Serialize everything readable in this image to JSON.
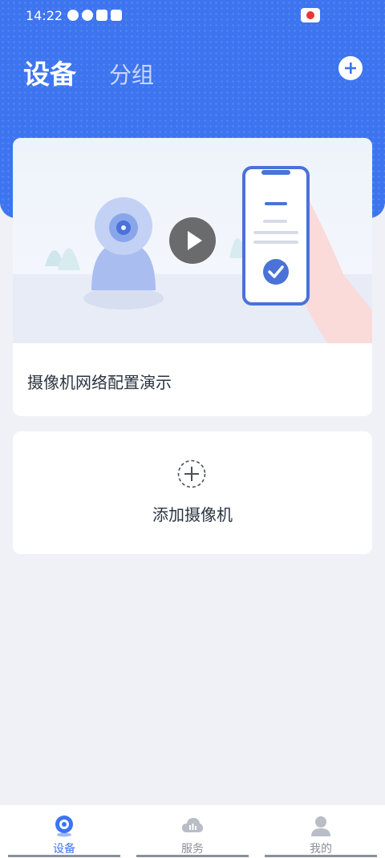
{
  "status": {
    "time": "14:22"
  },
  "header": {
    "tab_devices": "设备",
    "tab_groups": "分组"
  },
  "demo_card": {
    "title": "摄像机网络配置演示"
  },
  "add_card": {
    "label": "添加摄像机"
  },
  "bottom_nav": [
    {
      "label": "设备",
      "icon": "camera-icon",
      "active": true
    },
    {
      "label": "服务",
      "icon": "cloud-icon",
      "active": false
    },
    {
      "label": "我的",
      "icon": "person-icon",
      "active": false
    }
  ],
  "colors": {
    "primary": "#3d74ef",
    "background": "#eff1f6"
  }
}
